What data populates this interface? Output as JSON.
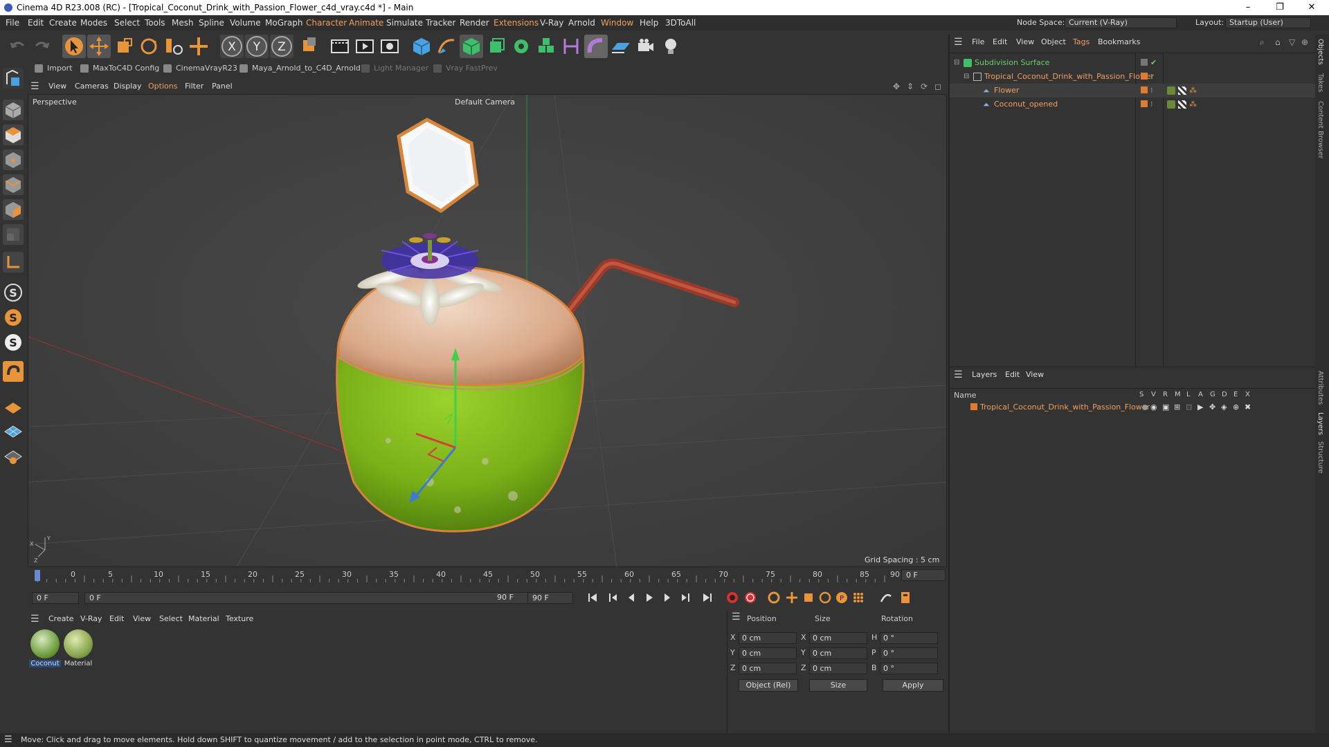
{
  "window": {
    "title": "Cinema 4D R23.008 (RC) - [Tropical_Coconut_Drink_with_Passion_Flower_c4d_vray.c4d *] - Main",
    "minimize": "–",
    "maximize": "❐",
    "close": "✕"
  },
  "menubar": {
    "items": [
      "File",
      "Edit",
      "Create",
      "Modes",
      "Select",
      "Tools",
      "Mesh",
      "Spline",
      "Volume",
      "MoGraph",
      "Character",
      "Animate",
      "Simulate",
      "Tracker",
      "Render",
      "Extensions",
      "V-Ray",
      "Arnold",
      "Window",
      "Help",
      "3DToAll"
    ],
    "node_space_label": "Node Space:",
    "node_space_value": "Current (V-Ray)",
    "layout_label": "Layout:",
    "layout_value": "Startup (User)"
  },
  "pluginbar": {
    "items": [
      "Import",
      "MaxToC4D Config",
      "CinemaVrayR23",
      "Maya_Arnold_to_C4D_Arnold",
      "Light Manager",
      "Vray FastPrev"
    ]
  },
  "viewport": {
    "menu": [
      "View",
      "Cameras",
      "Display",
      "Options",
      "Filter",
      "Panel"
    ],
    "projection": "Perspective",
    "camera": "Default Camera",
    "grid_spacing": "Grid Spacing : 5 cm"
  },
  "timeline": {
    "ticks": [
      "0",
      "5",
      "10",
      "15",
      "20",
      "25",
      "30",
      "35",
      "40",
      "45",
      "50",
      "55",
      "60",
      "65",
      "70",
      "75",
      "80",
      "85",
      "90"
    ],
    "current_frame_display": "0 F",
    "start_field": "0 F",
    "range_start": "0 F",
    "range_end": "90 F",
    "end_field": "90 F"
  },
  "materials": {
    "menu": [
      "Create",
      "V-Ray",
      "Edit",
      "View",
      "Select",
      "Material",
      "Texture"
    ],
    "items": [
      {
        "name": "Coconut",
        "color": "#6fa040"
      },
      {
        "name": "Material",
        "color": "#8aa850"
      }
    ]
  },
  "coords": {
    "headers": [
      "Position",
      "Size",
      "Rotation"
    ],
    "rows": [
      {
        "axis": "X",
        "pos": "0 cm",
        "size_axis": "X",
        "size": "0 cm",
        "rot_axis": "H",
        "rot": "0 °"
      },
      {
        "axis": "Y",
        "pos": "0 cm",
        "size_axis": "Y",
        "size": "0 cm",
        "rot_axis": "P",
        "rot": "0 °"
      },
      {
        "axis": "Z",
        "pos": "0 cm",
        "size_axis": "Z",
        "size": "0 cm",
        "rot_axis": "B",
        "rot": "0 °"
      }
    ],
    "mode": "Object (Rel)",
    "size_mode": "Size",
    "apply": "Apply"
  },
  "objects": {
    "menu": [
      "File",
      "Edit",
      "View",
      "Object",
      "Tags",
      "Bookmarks"
    ],
    "items": [
      {
        "name": "Subdivision Surface",
        "indent": 0
      },
      {
        "name": "Tropical_Coconut_Drink_with_Passion_Flower",
        "indent": 1
      },
      {
        "name": "Flower",
        "indent": 2
      },
      {
        "name": "Coconut_opened",
        "indent": 2
      }
    ]
  },
  "layers": {
    "menu": [
      "Layers",
      "Edit",
      "View"
    ],
    "name_header": "Name",
    "flag_headers": [
      "S",
      "V",
      "R",
      "M",
      "L",
      "A",
      "G",
      "D",
      "E",
      "X"
    ],
    "items": [
      {
        "name": "Tropical_Coconut_Drink_with_Passion_Flower",
        "color": "#e07a30"
      }
    ]
  },
  "right_tabs": [
    "Objects",
    "Takes",
    "Content Browser",
    "Attributes",
    "Layers",
    "Structure"
  ],
  "status": "Move: Click and drag to move elements. Hold down SHIFT to quantize movement / add to the selection in point mode, CTRL to remove.",
  "colors": {
    "accent": "#f0a060",
    "active": "#6ad06a"
  }
}
